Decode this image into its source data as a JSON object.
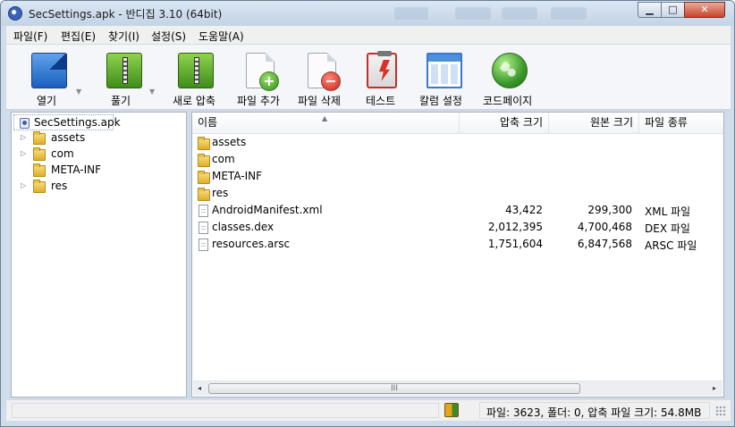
{
  "window": {
    "title": "SecSettings.apk - 반디집 3.10 (64bit)",
    "controls": {
      "minimize": "▁",
      "maximize": "□",
      "close": "✕"
    }
  },
  "menu": [
    "파일(F)",
    "편집(E)",
    "찾기(I)",
    "설정(S)",
    "도움말(A)"
  ],
  "toolbar": [
    {
      "label": "열기",
      "icon": "folder-open-icon",
      "dropdown": true
    },
    {
      "label": "풀기",
      "icon": "extract-icon",
      "dropdown": true
    },
    {
      "label": "새로 압축",
      "icon": "new-archive-icon"
    },
    {
      "label": "파일 추가",
      "icon": "add-file-icon"
    },
    {
      "label": "파일 삭제",
      "icon": "delete-file-icon"
    },
    {
      "label": "테스트",
      "icon": "test-icon"
    },
    {
      "label": "칼럼 설정",
      "icon": "columns-icon"
    },
    {
      "label": "코드페이지",
      "icon": "globe-icon"
    }
  ],
  "tree": {
    "root": "SecSettings.apk",
    "items": [
      {
        "label": "assets",
        "expandable": true
      },
      {
        "label": "com",
        "expandable": true
      },
      {
        "label": "META-INF",
        "expandable": false
      },
      {
        "label": "res",
        "expandable": true
      }
    ]
  },
  "list": {
    "columns": {
      "name": "이름",
      "packed": "압축 크기",
      "original": "원본 크기",
      "type": "파일 종류"
    },
    "rows": [
      {
        "name": "assets",
        "kind": "folder",
        "packed": "",
        "original": "",
        "type": ""
      },
      {
        "name": "com",
        "kind": "folder",
        "packed": "",
        "original": "",
        "type": ""
      },
      {
        "name": "META-INF",
        "kind": "folder",
        "packed": "",
        "original": "",
        "type": ""
      },
      {
        "name": "res",
        "kind": "folder",
        "packed": "",
        "original": "",
        "type": ""
      },
      {
        "name": "AndroidManifest.xml",
        "kind": "file",
        "packed": "43,422",
        "original": "299,300",
        "type": "XML 파일"
      },
      {
        "name": "classes.dex",
        "kind": "file",
        "packed": "2,012,395",
        "original": "4,700,468",
        "type": "DEX 파일"
      },
      {
        "name": "resources.arsc",
        "kind": "file",
        "packed": "1,751,604",
        "original": "6,847,568",
        "type": "ARSC 파일"
      }
    ],
    "scroll": {
      "left_arrow": "◂",
      "right_arrow": "▸",
      "thumb_grip": "III"
    }
  },
  "status": {
    "text": "파일: 3623, 폴더: 0, 압축 파일 크기: 54.8MB"
  },
  "colors": {
    "frame": "#cfdcea",
    "close": "#c6452b",
    "folder": "#e7c04f"
  }
}
